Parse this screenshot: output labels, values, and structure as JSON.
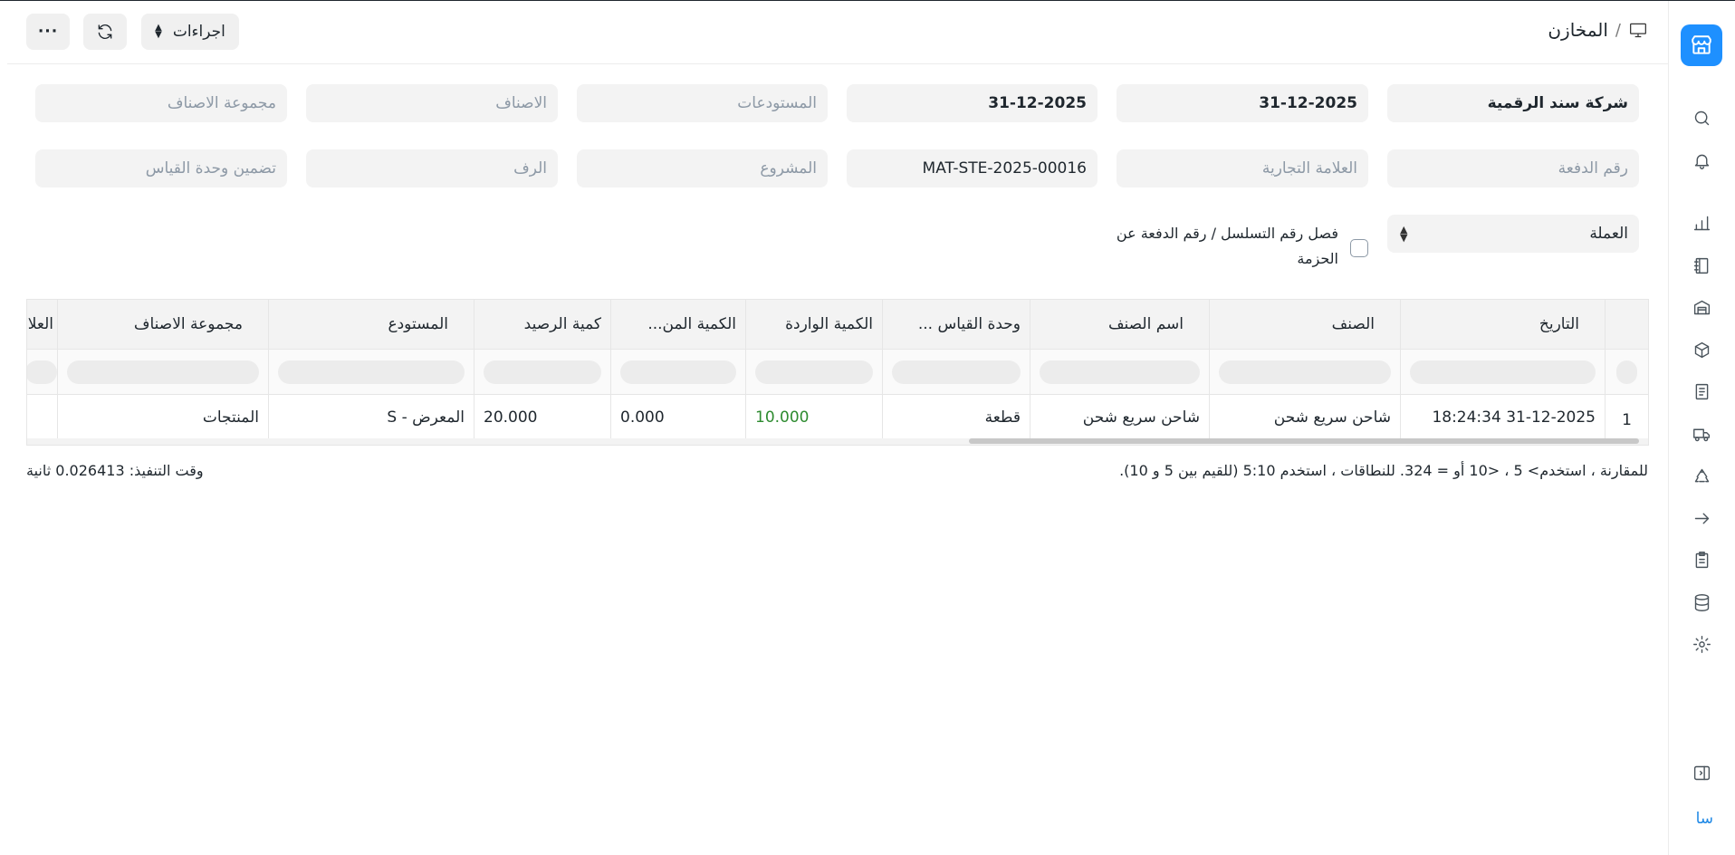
{
  "breadcrumb": {
    "separator": "/",
    "title": "المخازن"
  },
  "toolbar": {
    "actions_label": "اجراءات",
    "more_label": "···"
  },
  "filters": {
    "company": "شركة سند الرقمية",
    "from_date": "31-12-2025",
    "to_date": "31-12-2025",
    "warehouses_placeholder": "المستودعات",
    "items_placeholder": "الاصناف",
    "item_group_placeholder": "مجموعة الاصناف",
    "batch_no_placeholder": "رقم الدفعة",
    "brand_placeholder": "العلامة التجارية",
    "voucher_no": "MAT-STE-2025-00016",
    "project_placeholder": "المشروع",
    "shelf_placeholder": "الرف",
    "include_uom_placeholder": "تضمين وحدة القياس",
    "currency_label": "العملة",
    "separate_serial_line1": "فصل رقم التسلسل / رقم الدفعة عن",
    "separate_serial_line2": "الحزمة"
  },
  "table": {
    "columns": [
      "التاريخ",
      "الصنف",
      "اسم الصنف",
      "وحدة القياس ...",
      "الكمية الواردة",
      "الكمية المن...",
      "كمية الرصيد",
      "المستودع",
      "مجموعة الاصناف",
      "العلا"
    ],
    "rows": [
      {
        "index": "1",
        "date": "31-12-2025 18:24:34",
        "item": "شاحن سريع شحن",
        "item_name": "شاحن سريع شحن",
        "uom": "قطعة",
        "in_qty": "10.000",
        "out_qty": "0.000",
        "balance_qty": "20.000",
        "warehouse": "المعرض - S",
        "item_group": "المنتجات"
      }
    ]
  },
  "footer": {
    "hint": "للمقارنة ، استخدم> 5 ، <10 أو = 324. للنطاقات ، استخدم 5:10 (للقيم بين 5 و 10).",
    "execution_time": "وقت التنفيذ: 0.026413 ثانية"
  },
  "user": {
    "initials": "سا"
  },
  "colors": {
    "accent": "#1e90ff",
    "positive": "#2e8b30"
  }
}
